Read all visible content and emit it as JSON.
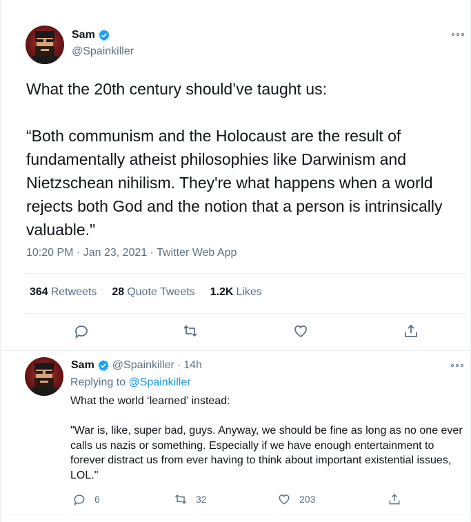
{
  "main_tweet": {
    "display_name": "Sam",
    "handle": "@Spainkiller",
    "text": "What the 20th century should’ve taught us:\n\n“Both communism and the Holocaust are the result of fundamentally atheist philosophies like Darwinism and Nietzschean nihilism. They're what happens when a world rejects both God and the notion that a person is intrinsically valuable.\"",
    "timestamp": "10:20 PM · Jan 23, 2021 · Twitter Web App",
    "stats": {
      "retweets_count": "364",
      "retweets_label": "Retweets",
      "quotes_count": "28",
      "quotes_label": "Quote Tweets",
      "likes_count": "1.2K",
      "likes_label": "Likes"
    },
    "actions": [
      "reply-icon",
      "retweet-icon",
      "like-icon",
      "share-icon"
    ]
  },
  "reply_tweet": {
    "display_name": "Sam",
    "handle": "@Spainkiller",
    "separator": "·",
    "time": "14h",
    "replying_prefix": "Replying to",
    "replying_handle": "@Spainkiller",
    "text": "What the world ‘learned’ instead:\n\n\"War is, like, super bad, guys. Anyway, we should be fine as long as no one ever calls us nazis or something. Especially if we have enough entertainment to forever distract us from ever having to think about important existential issues, LOL.\"",
    "reply_count": "6",
    "retweet_count": "32",
    "like_count": "203"
  },
  "colors": {
    "verified": "#1da1f2",
    "link": "#1b95e0",
    "secondary_text": "#5b7083",
    "border": "#ebeef0"
  }
}
